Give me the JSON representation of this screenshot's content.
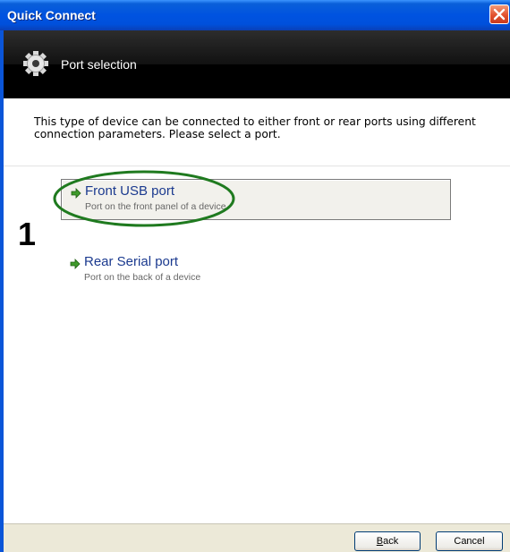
{
  "window": {
    "title": "Quick Connect"
  },
  "header": {
    "title": "Port selection",
    "icon": "gear-icon"
  },
  "description": "This type of device can be connected to either front or rear ports using different connection parameters. Please select a port.",
  "annotation": {
    "step_number": "1",
    "highlight_color": "#1f7a1f"
  },
  "options": [
    {
      "title": "Front USB port",
      "subtitle": "Port on the front panel of a device",
      "selected": true,
      "icon": "green-arrow-icon"
    },
    {
      "title": "Rear Serial port",
      "subtitle": "Port on the back of a device",
      "selected": false,
      "icon": "green-arrow-icon"
    }
  ],
  "footer": {
    "back_label_first": "B",
    "back_label_rest": "ack",
    "cancel_label": "Cancel"
  },
  "colors": {
    "titlebar": "#0053e0",
    "header_bg": "#000000",
    "link": "#1b3a8f",
    "footer_bg": "#ece9d8"
  }
}
